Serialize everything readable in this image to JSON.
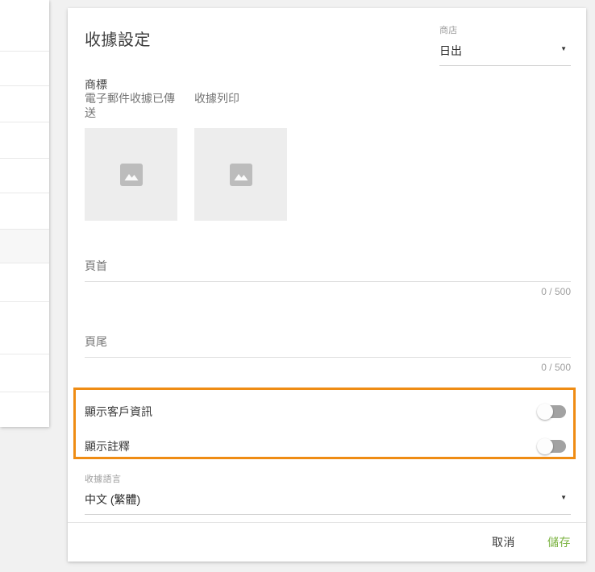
{
  "sidebar": {
    "visible_rows": 11,
    "selected_row_index": 6
  },
  "page": {
    "title": "收據設定",
    "store": {
      "label": "商店",
      "value": "日出"
    },
    "logo": {
      "section_label": "商標",
      "uploads": [
        {
          "label": "電子郵件收據已傳送"
        },
        {
          "label": "收據列印"
        }
      ]
    },
    "header_field": {
      "label": "頁首",
      "value": "",
      "counter": "0 / 500"
    },
    "footer_field": {
      "label": "頁尾",
      "value": "",
      "counter": "0 / 500"
    },
    "toggles": [
      {
        "label": "顯示客戶資訊",
        "state": "off"
      },
      {
        "label": "顯示註釋",
        "state": "off"
      }
    ],
    "language": {
      "label": "收據語言",
      "value": "中文 (繁體)"
    },
    "actions": {
      "cancel": "取消",
      "save": "儲存"
    }
  },
  "icons": {
    "dropdown_arrow": "▼"
  },
  "colors": {
    "highlight_orange": "#ef8c14",
    "save_green": "#7cb342",
    "page_background": "#f1f1f1"
  }
}
